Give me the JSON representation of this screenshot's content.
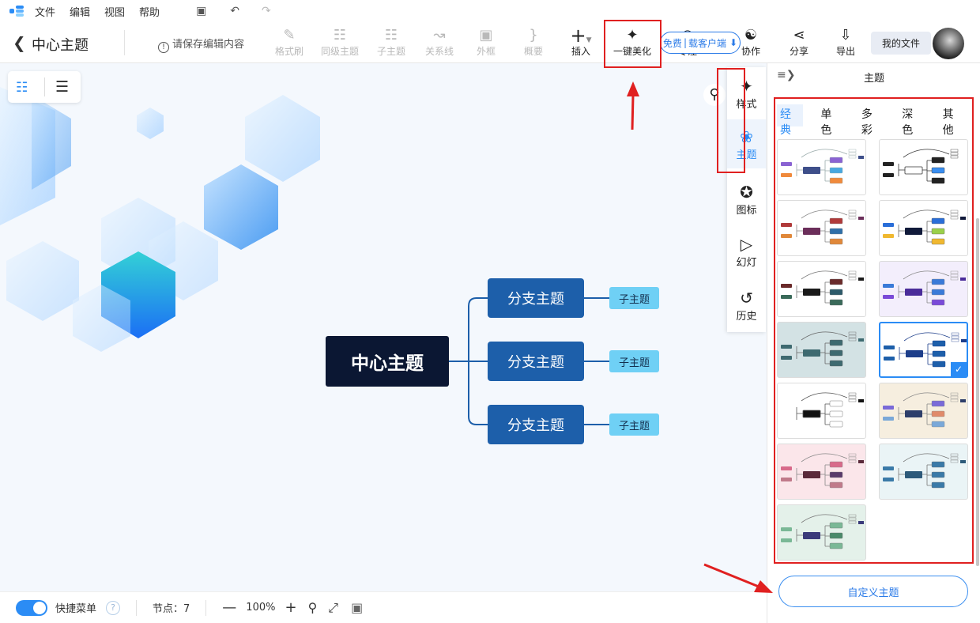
{
  "menubar": {
    "items": [
      "文件",
      "编辑",
      "视图",
      "帮助"
    ]
  },
  "header": {
    "back_icon": "chevron-left-icon",
    "title": "中心主题",
    "save_notice": "请保存编辑内容"
  },
  "toolbar": {
    "format_painter": "格式刷",
    "sibling_topic": "同级主题",
    "subtopic": "子主题",
    "relation_line": "关系线",
    "boundary": "外框",
    "summary": "概要",
    "insert": "插入",
    "beautify": "一键美化",
    "focus": "专注",
    "collaborate": "协作",
    "share": "分享",
    "export": "导出",
    "my_files": "我的文件"
  },
  "promo": {
    "part1": "免费",
    "part2": "载客户端"
  },
  "mindmap": {
    "center": "中心主题",
    "branches": [
      {
        "label": "分支主题",
        "child": "子主题"
      },
      {
        "label": "分支主题",
        "child": "子主题"
      },
      {
        "label": "分支主题",
        "child": "子主题"
      }
    ]
  },
  "side_tabs": [
    {
      "label": "样式",
      "icon": "magic-wand-icon"
    },
    {
      "label": "主题",
      "icon": "theme-icon",
      "active": true
    },
    {
      "label": "图标",
      "icon": "star-badge-icon"
    },
    {
      "label": "幻灯",
      "icon": "slides-icon"
    },
    {
      "label": "历史",
      "icon": "history-icon"
    }
  ],
  "panel": {
    "title": "主题",
    "categories": [
      "经典",
      "单色",
      "多彩",
      "深色",
      "其他"
    ],
    "active_category": "经典",
    "themes": [
      {
        "id": "classic-1",
        "selected": false
      },
      {
        "id": "classic-2",
        "selected": false
      },
      {
        "id": "classic-3",
        "selected": false
      },
      {
        "id": "classic-4",
        "selected": false
      },
      {
        "id": "classic-5",
        "selected": false
      },
      {
        "id": "classic-6",
        "selected": false
      },
      {
        "id": "classic-7",
        "selected": false
      },
      {
        "id": "classic-8",
        "selected": true
      },
      {
        "id": "classic-9",
        "selected": false
      },
      {
        "id": "classic-10",
        "selected": false
      },
      {
        "id": "classic-11",
        "selected": false
      },
      {
        "id": "classic-12",
        "selected": false
      },
      {
        "id": "classic-13",
        "selected": false
      }
    ],
    "custom_button": "自定义主题"
  },
  "statusbar": {
    "quick_menu": "快捷菜单",
    "help": "?",
    "node_count": "节点：7",
    "zoom": "100%"
  },
  "colors": {
    "accent": "#2b8cf5",
    "center_node": "#0b1733",
    "branch_node": "#1d5faa",
    "sub_node": "#6fd0f5",
    "highlight": "#e02020"
  }
}
